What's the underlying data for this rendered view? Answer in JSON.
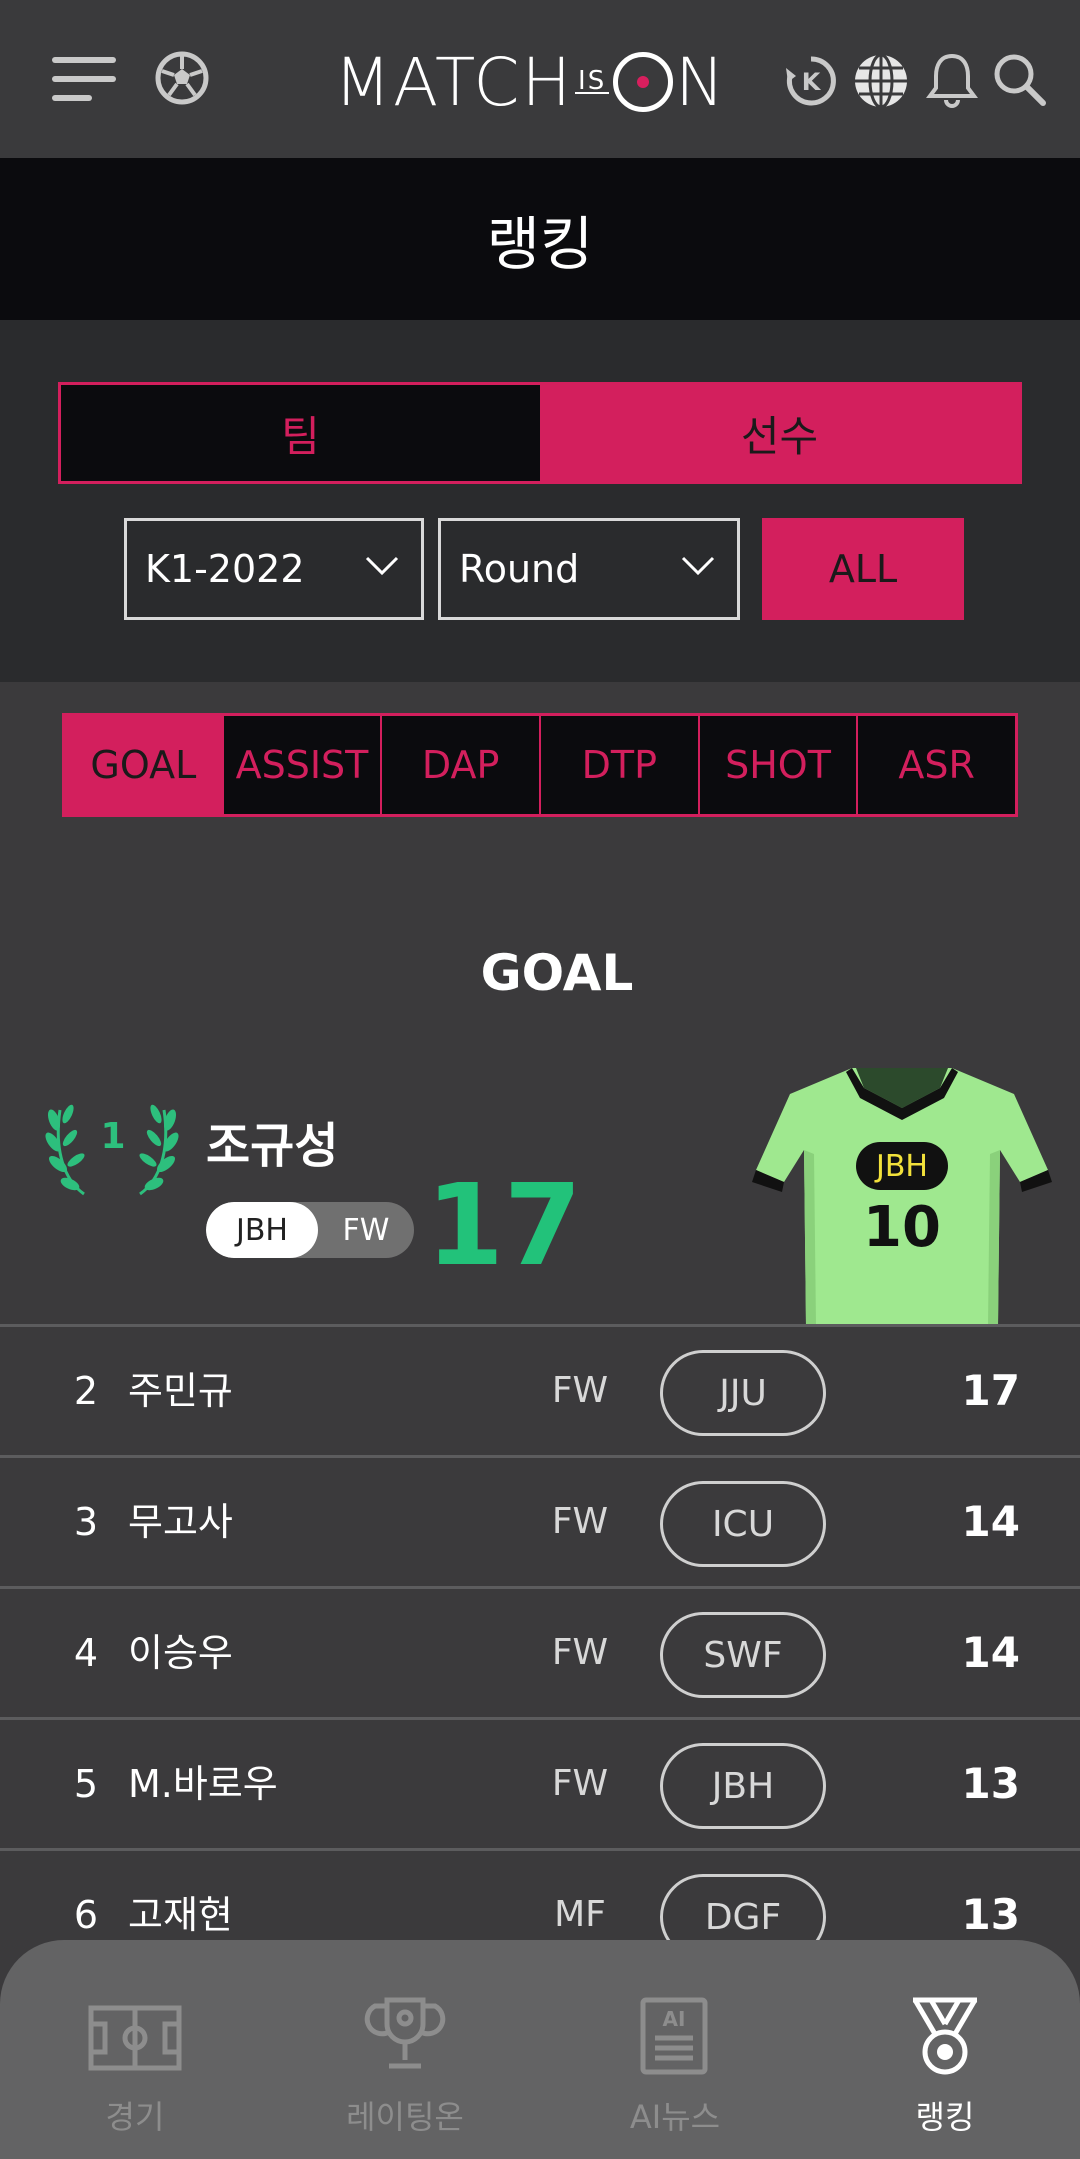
{
  "header": {
    "logo_text": "MATCHISON",
    "logo_part1": "MATCH",
    "logo_is": "IS",
    "logo_part2": "N"
  },
  "page_title": "랭킹",
  "filters": {
    "tabs": [
      {
        "label": "팀",
        "active": false
      },
      {
        "label": "선수",
        "active": true
      }
    ],
    "season_select": "K1-2022",
    "round_select": "Round",
    "all_button": "ALL"
  },
  "stat_tabs": [
    {
      "label": "GOAL",
      "active": true
    },
    {
      "label": "ASSIST",
      "active": false
    },
    {
      "label": "DAP",
      "active": false
    },
    {
      "label": "DTP",
      "active": false
    },
    {
      "label": "SHOT",
      "active": false
    },
    {
      "label": "ASR",
      "active": false
    }
  ],
  "stat_title": "GOAL",
  "first_place": {
    "rank": "1",
    "name": "조규성",
    "team": "JBH",
    "position": "FW",
    "value": "17",
    "jersey_team": "JBH",
    "jersey_number": "10"
  },
  "rankings": [
    {
      "rank": "2",
      "name": "주민규",
      "position": "FW",
      "team": "JJU",
      "value": "17"
    },
    {
      "rank": "3",
      "name": "무고사",
      "position": "FW",
      "team": "ICU",
      "value": "14"
    },
    {
      "rank": "4",
      "name": "이승우",
      "position": "FW",
      "team": "SWF",
      "value": "14"
    },
    {
      "rank": "5",
      "name": "M.바로우",
      "position": "FW",
      "team": "JBH",
      "value": "13"
    },
    {
      "rank": "6",
      "name": "고재현",
      "position": "MF",
      "team": "DGF",
      "value": "13"
    }
  ],
  "bottom_nav": [
    {
      "label": "경기",
      "active": false
    },
    {
      "label": "레이팅온",
      "active": false
    },
    {
      "label": "AI뉴스",
      "active": false
    },
    {
      "label": "랭킹",
      "active": true
    }
  ],
  "colors": {
    "accent": "#d31f5d",
    "score_green": "#22c27a",
    "jersey_green": "#9fe88f"
  }
}
